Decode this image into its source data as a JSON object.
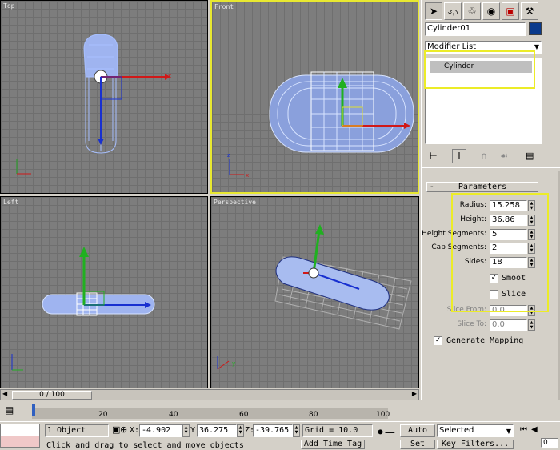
{
  "viewports": {
    "top": {
      "label": "Top"
    },
    "front": {
      "label": "Front"
    },
    "left": {
      "label": "Left"
    },
    "perspective": {
      "label": "Perspective"
    }
  },
  "panel": {
    "object_name": "Cylinder01",
    "modifier_list": "Modifier List",
    "stack_item": "Cylinder",
    "rollout_title": "Parameters",
    "rollout_toggle": "-",
    "params": [
      {
        "label": "Radius:",
        "value": "15.258"
      },
      {
        "label": "Height:",
        "value": "36.86"
      },
      {
        "label": "Height Segments:",
        "value": "5"
      },
      {
        "label": "Cap Segments:",
        "value": "2"
      },
      {
        "label": "Sides:",
        "value": "18"
      }
    ],
    "smooth_label": "Smoot",
    "slice_label": "Slice",
    "slice_from_label": "Slice From:",
    "slice_from_value": "0.0",
    "slice_to_label": "Slice To:",
    "slice_to_value": "0.0",
    "gen_mapping_label": "Generate Mapping",
    "accent_color": "#0a3a8c"
  },
  "timeline": {
    "frame_counter": "0 / 100",
    "ticks": [
      "20",
      "40",
      "60",
      "80",
      "100"
    ]
  },
  "status": {
    "selection": "1 Object",
    "x_label": "X:",
    "x_value": "-4.902",
    "y_label": "Y:",
    "y_value": "36.275",
    "z_label": "Z:",
    "z_value": "-39.765",
    "grid": "Grid = 10.0",
    "auto_key": "Auto Key",
    "selected": "Selected",
    "prompt": "Click and drag to select and move objects",
    "add_time_tag": "Add Time Tag",
    "set_key": "Set Key",
    "key_filters": "Key Filters...",
    "frame_field": "0"
  },
  "axis": {
    "x": "x",
    "y": "y",
    "z": "z"
  }
}
